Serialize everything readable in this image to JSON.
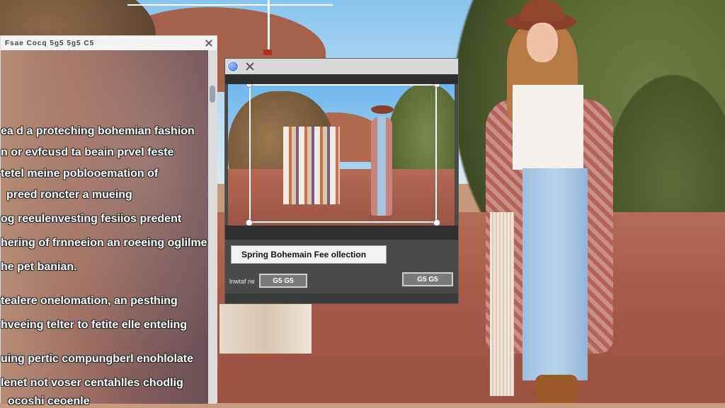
{
  "left_window": {
    "title": "Fsae Cocq 5g5 5g5 C5",
    "text_lines": [
      "ea d a proteching bohemian fashion",
      "n or evfcusd ta beain prvel feste",
      "tetel meine poblooemation of",
      "preed roncter a mueing",
      "og reeulenvesting fesiios predent",
      "hering of frnneeion an roeeing oglilme",
      "he pet banian.",
      "tealere onelomation, an pesthing",
      "hveeing telter to fetite elle enteling",
      "uing pertic compungberl enohlolate",
      "lenet not voser centahlles chodlig",
      "ocoshi ceoenle"
    ]
  },
  "dialog": {
    "title_value": "Spring Bohemain Fee ollection",
    "field_label": "lnwtaf ne",
    "left_button_label": "G5 G5",
    "right_button_label": "G5 G5"
  },
  "colors": {
    "accent_blue": "#2f6fdc",
    "dialog_bg": "#4a4a4a",
    "ground": "#a85c48"
  }
}
